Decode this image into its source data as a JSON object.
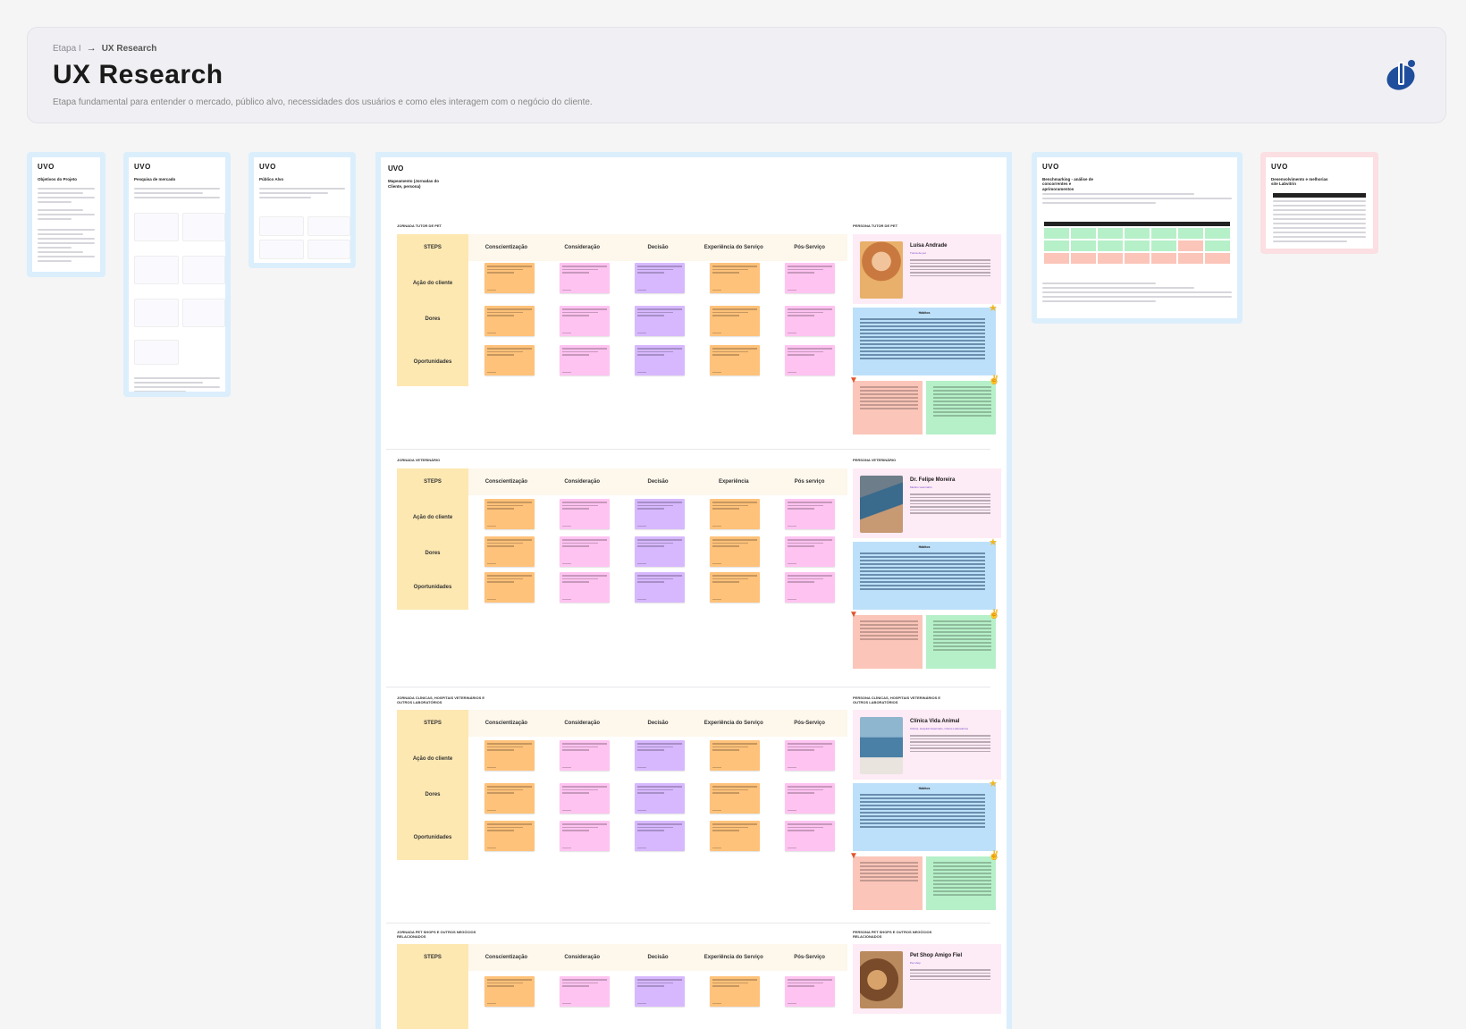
{
  "header": {
    "breadcrumb_parent": "Etapa I",
    "breadcrumb_arrow": "→",
    "breadcrumb_current": "UX Research",
    "title": "UX Research",
    "subtitle": "Etapa fundamental para entender o mercado, público alvo, necessidades dos usuários e como eles interagem com o negócio do cliente."
  },
  "brand": "UVO",
  "frames": {
    "objetivos": "Objetivos do Projeto",
    "pesquisa": "Pesquisa de mercado",
    "publico": "Público Alvo",
    "benchmarking": "Benchmarking - análise de concorrentes e aprimoramentos",
    "desenvolvimento": "Desenvolvimento e melhorias site Labvitrin",
    "mapeamento": "Mapeamento (Jornadas do Cliente, persona)"
  },
  "steps_label": "STEPS",
  "row_labels": [
    "Ação do cliente",
    "Dores",
    "Oportunidades"
  ],
  "journeys": [
    {
      "label": "JORNADA TUTOR DE PET",
      "persona_label": "PERSONA TUTOR DE PET",
      "steps": [
        "Conscientização",
        "Consideração",
        "Decisão",
        "Experiência do Serviço",
        "Pós-Serviço"
      ],
      "persona_name": "Luísa Andrade",
      "persona_role": "Tutora de pet"
    },
    {
      "label": "JORNADA VETERINÁRIO",
      "persona_label": "PERSONA VETERINÁRIO",
      "steps": [
        "Conscientização",
        "Consideração",
        "Decisão",
        "Experiência",
        "Pós serviço"
      ],
      "persona_name": "Dr. Felipe Moreira",
      "persona_role": "Médico veterinário"
    },
    {
      "label": "JORNADA CLÍNICAS, HOSPITAIS VETERINÁRIOS E OUTROS LABORATÓRIOS",
      "persona_label": "PERSONA CLÍNICAS, HOSPITAIS VETERINÁRIOS E OUTROS LABORATÓRIOS",
      "steps": [
        "Conscientização",
        "Consideração",
        "Decisão",
        "Experiência do Serviço",
        "Pós-Serviço"
      ],
      "persona_name": "Clínica Vida Animal",
      "persona_role": "Clínica, Hospital Veterinário, Outros Laboratórios"
    },
    {
      "label": "JORNADA PET SHOPS E OUTROS NEGÓCIOS RELACIONADOS",
      "persona_label": "PERSONA PET SHOPS E OUTROS NEGÓCIOS RELACIONADOS",
      "steps": [
        "Conscientização",
        "Consideração",
        "Decisão",
        "Experiência do Serviço",
        "Pós-Serviço"
      ],
      "persona_name": "Pet Shop Amigo Fiel",
      "persona_role": "Pet shop"
    }
  ],
  "persona_box_title": "Hábitos",
  "colors": {
    "orange": "#ffc27a",
    "pink": "#ffc3f1",
    "purple": "#d7b8ff",
    "yellow": "#fde8b2",
    "blue": "#bde0fa",
    "red": "#fbc5b9",
    "green": "#b6f0c8"
  }
}
